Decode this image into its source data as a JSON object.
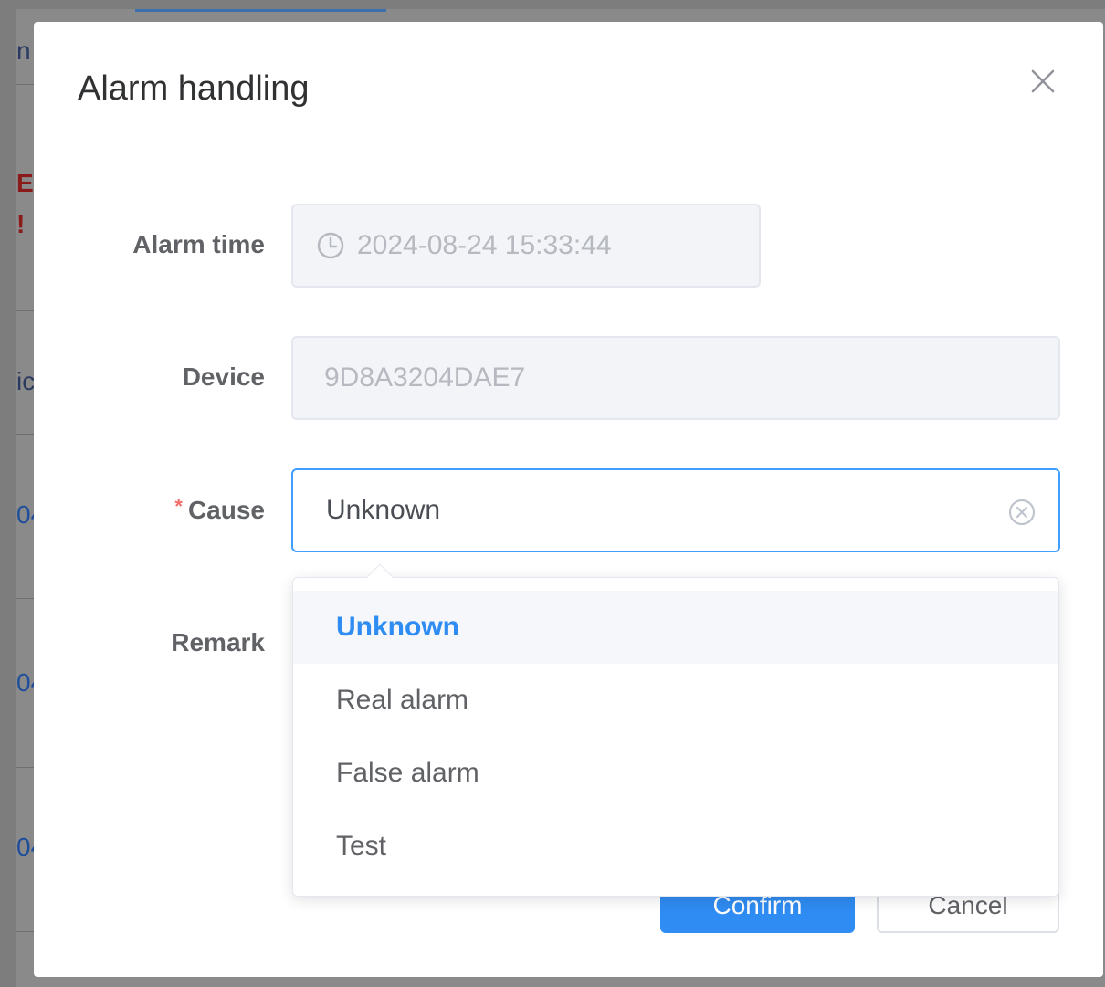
{
  "background": {
    "fragments": [
      "n",
      "E",
      "!",
      "ic",
      "04",
      "04",
      "04"
    ]
  },
  "dialog": {
    "title": "Alarm handling",
    "close_icon": "close-icon"
  },
  "form": {
    "alarm_time": {
      "label": "Alarm time",
      "value": "2024-08-24 15:33:44",
      "icon": "clock-icon"
    },
    "device": {
      "label": "Device",
      "value": "9D8A3204DAE7"
    },
    "cause": {
      "required_mark": "*",
      "label": "Cause",
      "value": "Unknown",
      "clear_icon": "circle-x-icon"
    },
    "remark": {
      "label": "Remark"
    }
  },
  "dropdown": {
    "options": [
      "Unknown",
      "Real alarm",
      "False alarm",
      "Test"
    ],
    "selected": "Unknown"
  },
  "footer": {
    "confirm_label": "Confirm",
    "cancel_label": "Cancel"
  },
  "colors": {
    "primary": "#2f8cf2",
    "required": "#f56c6c",
    "focus_border": "#409eff"
  }
}
